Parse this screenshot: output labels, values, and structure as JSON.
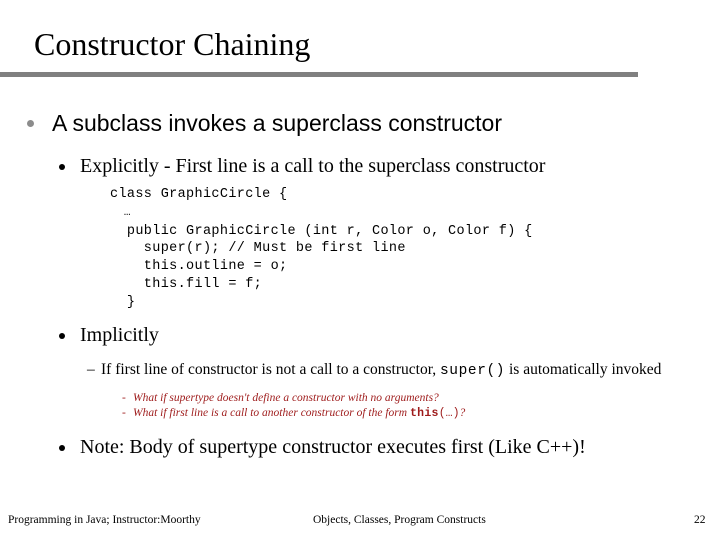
{
  "slide": {
    "title": "Constructor Chaining",
    "rule_color": "#808080",
    "accent_red": "#9e1b1b",
    "bullet_level1_color": "#8c8c8c",
    "bullet_level2_color": "#000000"
  },
  "content": {
    "bullet1": "A subclass invokes a superclass constructor",
    "bullet1_sub1": "Explicitly - First line is a call to the superclass constructor",
    "code": {
      "line1": "class GraphicCircle {",
      "line2": "  …",
      "line3": "  public GraphicCircle (int r, Color o, Color f) {",
      "line4": "    super(r); // Must be first line",
      "line5": "    this.outline = o;",
      "line6": "    this.fill = f;",
      "line7": "  }"
    },
    "bullet1_sub2": "Implicitly",
    "implicit_detail": {
      "dash": "–",
      "text_before": "If first line of constructor is not a call to a constructor, ",
      "code": "super()",
      "text_after": " is automatically invoked"
    },
    "questions": [
      {
        "dash": "-",
        "text": "What if supertype doesn't define a constructor with no arguments?"
      },
      {
        "dash": "-",
        "text_before": "What if first line is a call to another constructor of the form ",
        "code_bold": "this",
        "code_tail": "(…)",
        "text_after": "?"
      }
    ],
    "bullet1_sub3": "Note: Body of supertype constructor executes first (Like C++)!"
  },
  "footer": {
    "left": "Programming in Java; Instructor:Moorthy",
    "center": "Objects, Classes, Program Constructs",
    "page": "22"
  }
}
